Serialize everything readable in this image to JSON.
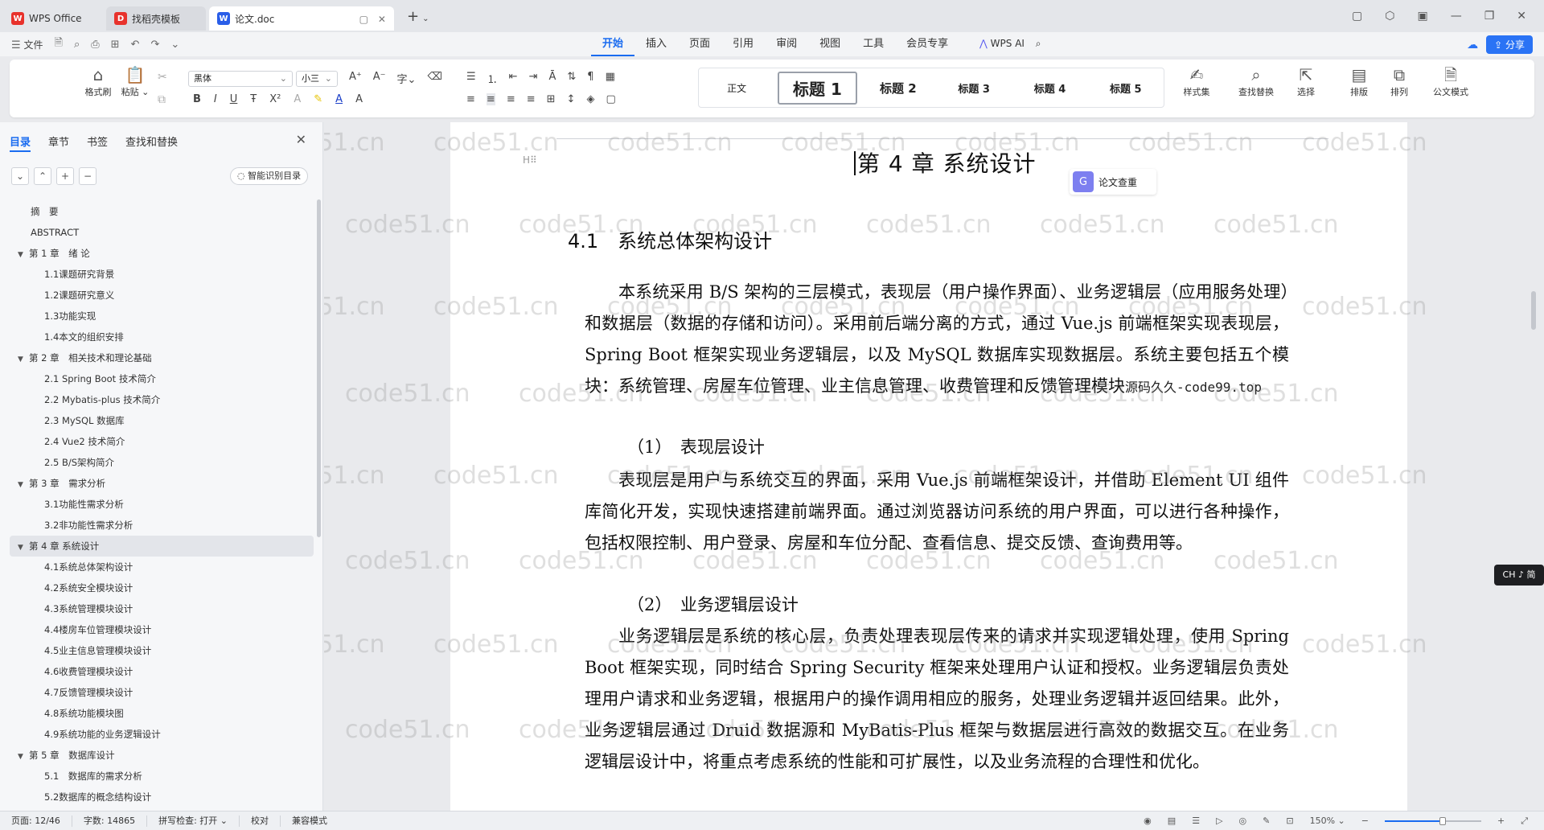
{
  "tabs": [
    {
      "label": "WPS Office"
    },
    {
      "label": "找稻壳模板"
    },
    {
      "label": "论文.doc"
    }
  ],
  "menu": {
    "file_label": "文件",
    "tabs": [
      "开始",
      "插入",
      "页面",
      "引用",
      "审阅",
      "视图",
      "工具",
      "会员专享"
    ],
    "ai_label": "WPS AI",
    "share_label": "分享"
  },
  "ribbon": {
    "format_brush": "格式刷",
    "paste": "粘贴",
    "font_name": "黑体",
    "font_size": "小三",
    "styles": [
      "正文",
      "标题 1",
      "标题 2",
      "标题 3",
      "标题 4",
      "标题 5"
    ],
    "style_set": "样式集",
    "find_replace": "查找替换",
    "select": "选择",
    "layout": "排版",
    "arrange": "排列",
    "official_mode": "公文模式"
  },
  "sidebar": {
    "tabs": [
      "目录",
      "章节",
      "书签",
      "查找和替换"
    ],
    "smart_toc": "智能识别目录",
    "toc": [
      {
        "label": "摘　要",
        "level": 0
      },
      {
        "label": "ABSTRACT",
        "level": 0
      },
      {
        "label": "第 1 章　绪 论",
        "level": 1,
        "expand": true
      },
      {
        "label": "1.1课题研究背景",
        "level": 2
      },
      {
        "label": "1.2课题研究意义",
        "level": 2
      },
      {
        "label": "1.3功能实现",
        "level": 2
      },
      {
        "label": "1.4本文的组织安排",
        "level": 2
      },
      {
        "label": "第 2 章　相关技术和理论基础",
        "level": 1,
        "expand": true
      },
      {
        "label": "2.1 Spring Boot 技术简介",
        "level": 2
      },
      {
        "label": "2.2 Mybatis-plus 技术简介",
        "level": 2
      },
      {
        "label": "2.3 MySQL 数据库",
        "level": 2
      },
      {
        "label": "2.4 Vue2 技术简介",
        "level": 2
      },
      {
        "label": "2.5 B/S架构简介",
        "level": 2
      },
      {
        "label": "第 3 章　需求分析",
        "level": 1,
        "expand": true
      },
      {
        "label": "3.1功能性需求分析",
        "level": 2
      },
      {
        "label": "3.2非功能性需求分析",
        "level": 2
      },
      {
        "label": "第 4 章 系统设计",
        "level": 1,
        "expand": true,
        "selected": true
      },
      {
        "label": "4.1系统总体架构设计",
        "level": 2
      },
      {
        "label": "4.2系统安全模块设计",
        "level": 2
      },
      {
        "label": "4.3系统管理模块设计",
        "level": 2
      },
      {
        "label": "4.4楼房车位管理模块设计",
        "level": 2
      },
      {
        "label": "4.5业主信息管理模块设计",
        "level": 2
      },
      {
        "label": "4.6收费管理模块设计",
        "level": 2
      },
      {
        "label": "4.7反馈管理模块设计",
        "level": 2
      },
      {
        "label": "4.8系统功能模块图",
        "level": 2
      },
      {
        "label": "4.9系统功能的业务逻辑设计",
        "level": 2
      },
      {
        "label": "第 5 章　数据库设计",
        "level": 1,
        "expand": true
      },
      {
        "label": "5.1　数据库的需求分析",
        "level": 2
      },
      {
        "label": "5.2数据库的概念结构设计",
        "level": 2
      }
    ]
  },
  "document": {
    "chapter_title": "第 4 章  系统设计",
    "heading_marker": "H",
    "section_heading": "4.1　系统总体架构设计",
    "para1": "本系统采用 B/S 架构的三层模式，表现层（用户操作界面）、业务逻辑层（应用服务处理）和数据层（数据的存储和访问）。采用前后端分离的方式，通过 Vue.js 前端框架实现表现层，Spring Boot 框架实现业务逻辑层，以及 MySQL 数据库实现数据层。系统主要包括五个模块：系统管理、房屋车位管理、业主信息管理、收费管理和反馈管理模块",
    "para1_source": "源码久久-code99.top",
    "sub1": "（1）　表现层设计",
    "para2": "表现层是用户与系统交互的界面，采用 Vue.js 前端框架设计，并借助 Element UI 组件库简化开发，实现快速搭建前端界面。通过浏览器访问系统的用户界面，可以进行各种操作，包括权限控制、用户登录、房屋和车位分配、查看信息、提交反馈、查询费用等。",
    "sub2": "（2）　业务逻辑层设计",
    "para3": "业务逻辑层是系统的核心层，负责处理表现层传来的请求并实现逻辑处理，使用 Spring Boot 框架实现，同时结合 Spring Security 框架来处理用户认证和授权。业务逻辑层负责处理用户请求和业务逻辑，根据用户的操作调用相应的服务，处理业务逻辑并返回结果。此外，业务逻辑层通过 Druid 数据源和 MyBatis-Plus 框架与数据层进行高效的数据交互。在业务逻辑层设计中，将重点考虑系统的性能和可扩展性，以及业务流程的合理性和优化。",
    "float_button": "论文查重",
    "ime": "CH ♪ 简"
  },
  "watermark": "code51.cn",
  "status": {
    "page": "页面: 12/46",
    "words": "字数: 14865",
    "spell": "拼写检查: 打开",
    "proof": "校对",
    "compat": "兼容模式",
    "zoom": "150%",
    "zoom_fraction": 0.6
  }
}
